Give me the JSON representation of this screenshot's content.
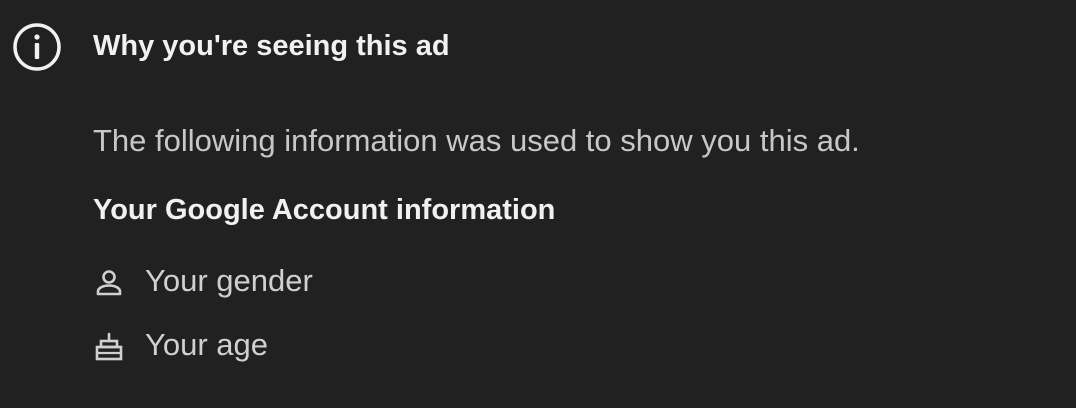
{
  "header": {
    "icon": "info-icon",
    "title": "Why you're seeing this ad"
  },
  "body": {
    "description": "The following information was used to show you this ad.",
    "section_heading": "Your Google Account information",
    "items": [
      {
        "icon": "person-icon",
        "label": "Your gender"
      },
      {
        "icon": "cake-icon",
        "label": "Your age"
      }
    ]
  },
  "colors": {
    "background": "#212121",
    "title_text": "#f1f1f1",
    "body_text": "#c8c8c8"
  }
}
